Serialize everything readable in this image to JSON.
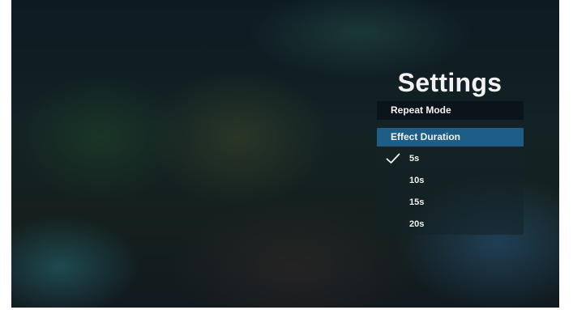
{
  "settings": {
    "title": "Settings",
    "repeat_mode_label": "Repeat Mode",
    "effect_duration_label": "Effect Duration",
    "options": [
      {
        "label": "5s",
        "selected": true
      },
      {
        "label": "10s",
        "selected": false
      },
      {
        "label": "15s",
        "selected": false
      },
      {
        "label": "20s",
        "selected": false
      }
    ]
  },
  "colors": {
    "highlight": "#1e5d86",
    "text": "#f2f2f2"
  },
  "icons": {
    "selected": "check-icon"
  }
}
